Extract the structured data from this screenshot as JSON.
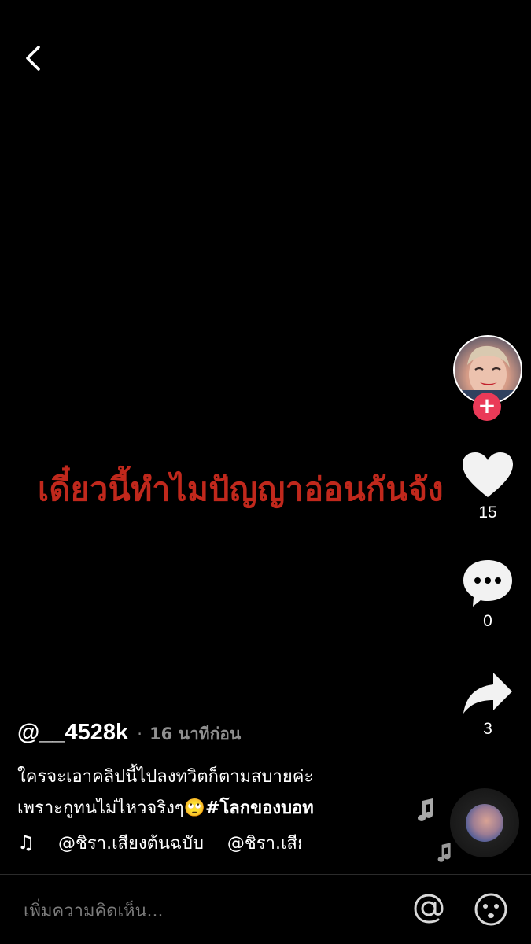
{
  "video": {
    "overlay_text": "เดี๋ยวนี้ทำไมปัญญาอ่อนกันจัง"
  },
  "rail": {
    "like_count": "15",
    "comment_count": "0",
    "share_count": "3",
    "follow_symbol": "+"
  },
  "post": {
    "author": "@__4528k",
    "separator": "·",
    "time_ago": "16 นาทีก่อน",
    "description_line1": "ใครจะเอาคลิปนี้ไปลงทวิตก็ตามสบายค่ะ",
    "description_line2": "เพราะกูทนไม่ไหวจริงๆ",
    "emoji": "🙄",
    "hashtag": "#โลกของบอท"
  },
  "music": {
    "note_symbol": "♫",
    "track_text": "@ชิรา.เสียงต้นฉบับ",
    "track_text_repeat": "@ชิรา.เสียงต้นฉบับ"
  },
  "comment_bar": {
    "placeholder": "เพิ่มความคิดเห็น..."
  },
  "colors": {
    "background": "#000000",
    "overlay_text": "#c0281c",
    "follow_badge": "#ea3a58",
    "secondary_text": "#8f8f8f"
  },
  "icons": {
    "back": "chevron-left-icon",
    "like": "heart-icon",
    "comment": "speech-bubble-icon",
    "share": "share-arrow-icon",
    "mention": "at-sign-icon",
    "emoji": "smiley-icon",
    "music": "music-note-icon"
  }
}
